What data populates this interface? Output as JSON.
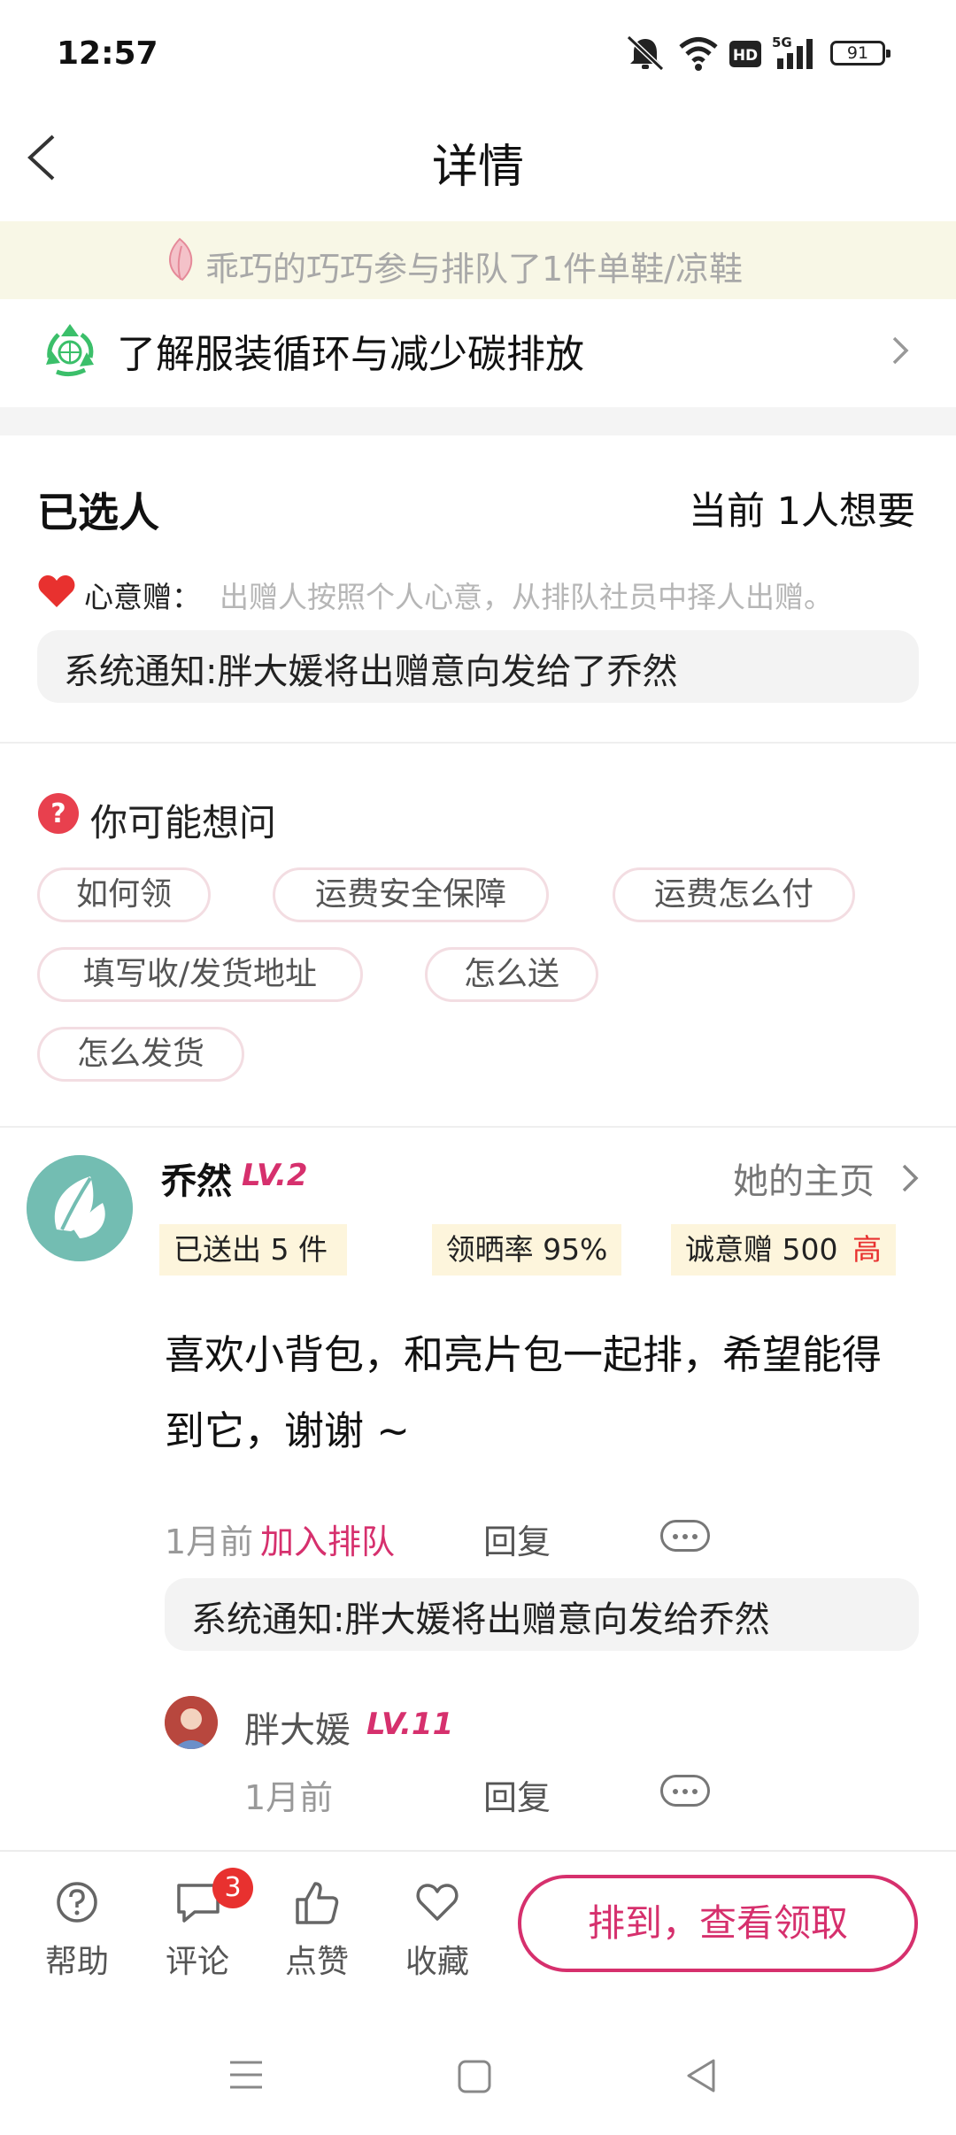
{
  "status_bar": {
    "time": "12:57",
    "battery": "91"
  },
  "header": {
    "title": "详情"
  },
  "queue_banner": {
    "text": "乖巧的巧巧参与排队了1件单鞋/凉鞋"
  },
  "recycle": {
    "label": "了解服装循环与减少碳排放"
  },
  "selected": {
    "title": "已选人",
    "wanted_count": "当前 1人想要",
    "heart_label": "心意赠：",
    "heart_desc": "出赠人按照个人心意，从排队社员中择人出赠。",
    "notice": "系统通知:胖大媛将出赠意向发给了乔然"
  },
  "faq": {
    "title": "你可能想问",
    "chips": [
      "如何领",
      "运费安全保障",
      "运费怎么付",
      "填写收/发货地址",
      "怎么送",
      "怎么发货"
    ]
  },
  "comment": {
    "user_name": "乔然",
    "user_level": "LV.2",
    "homepage_label": "她的主页",
    "stats": {
      "sent": "已送出 5 件",
      "claim_rate": "领晒率 95%",
      "sincerity": "诚意赠 500",
      "sincerity_tag": "高"
    },
    "text": "喜欢小背包，和亮片包一起排，希望能得到它，谢谢 ~",
    "time": "1月前",
    "join_label": "加入排队",
    "reply_label": "回复",
    "notice": "系统通知:胖大媛将出赠意向发给乔然"
  },
  "reply": {
    "user_name": "胖大媛",
    "user_level": "LV.11",
    "time": "1月前",
    "reply_label": "回复"
  },
  "bottom_bar": {
    "help": "帮助",
    "comments": "评论",
    "comments_badge": "3",
    "like": "点赞",
    "favorite": "收藏",
    "cta": "排到，查看领取"
  },
  "colors": {
    "accent": "#d6306d",
    "banner_bg": "#f8f7e6",
    "stat_bg": "#fdf5dc",
    "badge": "#e8312f"
  }
}
